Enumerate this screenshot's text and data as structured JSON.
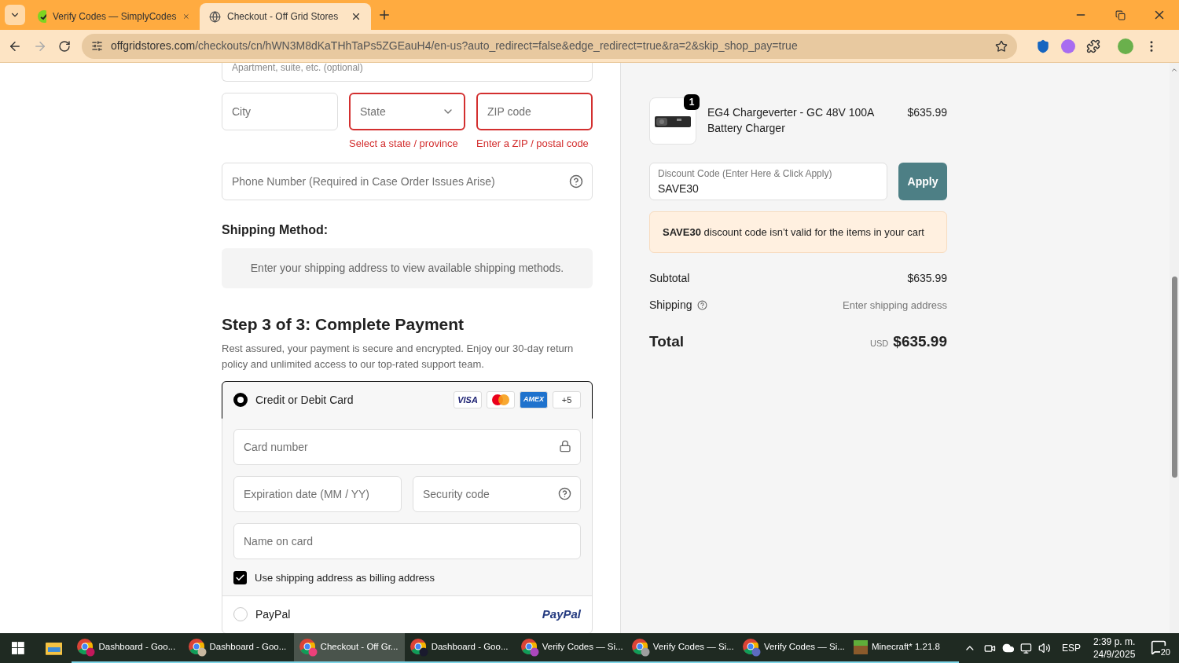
{
  "browser": {
    "tabs": [
      {
        "title": "Verify Codes — SimplyCodes",
        "kind": "simplycodes",
        "selected": false
      },
      {
        "title": "Checkout - Off Grid Stores",
        "kind": "globe",
        "selected": true
      }
    ],
    "url": {
      "domain": "offgridstores.com",
      "path": "/checkouts/cn/hWN3M8dKaTHhTaPs5ZGEauH4/en-us?auto_redirect=false&edge_redirect=true&ra=2&skip_shop_pay=true"
    }
  },
  "address": {
    "apartment": {
      "placeholder": "Apartment, suite, etc. (optional)"
    },
    "fields": [
      {
        "kind": "input",
        "placeholder": "City",
        "invalid": false
      },
      {
        "kind": "select",
        "placeholder": "State",
        "invalid": true,
        "error": "Select a state / province"
      },
      {
        "kind": "input",
        "placeholder": "ZIP code",
        "invalid": true,
        "error": "Enter a ZIP / postal code"
      }
    ],
    "phone": {
      "placeholder": "Phone Number (Required in Case Order Issues Arise)"
    }
  },
  "shipping_method": {
    "title": "Shipping Method:",
    "message": "Enter your shipping address to view available shipping methods."
  },
  "payment": {
    "title": "Step 3 of 3: Complete Payment",
    "description": "Rest assured, your payment is secure and encrypted. Enjoy our 30-day return policy and unlimited access to our top-rated support team.",
    "methods": [
      {
        "kind": "card",
        "label": "Credit or Debit Card",
        "selected": true,
        "brands": [
          {
            "kind": "visa",
            "label": "VISA"
          },
          {
            "kind": "mastercard"
          },
          {
            "kind": "amex",
            "label": "AMEX"
          },
          {
            "kind": "more",
            "label": "+5"
          }
        ],
        "fields": [
          {
            "kind": "number",
            "placeholder": "Card number"
          },
          {
            "kind": "expiry",
            "placeholder": "Expiration date (MM / YY)"
          },
          {
            "kind": "security",
            "placeholder": "Security code"
          },
          {
            "kind": "name",
            "placeholder": "Name on card"
          }
        ],
        "billing": {
          "label": "Use shipping address as billing address",
          "checked": true
        }
      },
      {
        "kind": "paypal",
        "label": "PayPal",
        "selected": false,
        "logo": "PayPal"
      }
    ]
  },
  "summary": {
    "item": {
      "quantity": "1",
      "name": "EG4 Chargeverter - GC 48V 100A Battery Charger",
      "price": "$635.99"
    },
    "discount": {
      "label": "Discount Code (Enter Here & Click Apply)",
      "value": "SAVE30",
      "button": "Apply"
    },
    "alert": "**SAVE30** discount code isn’t valid for the items in your cart",
    "subtotal": {
      "label": "Subtotal",
      "value": "$635.99"
    },
    "shipping": {
      "label": "Shipping",
      "value": "Enter shipping address"
    },
    "total": {
      "label": "Total",
      "currency": "USD",
      "value": "$635.99"
    }
  },
  "taskbar": {
    "apps": [
      {
        "kind": "chrome",
        "label": "Dashboard - Goo...",
        "color": "#c2185b",
        "selected": false
      },
      {
        "kind": "chrome",
        "label": "Dashboard - Goo...",
        "color": "#c8b8a0",
        "selected": false
      },
      {
        "kind": "chrome",
        "label": "Checkout - Off Gr...",
        "color": "#ec407a",
        "selected": true
      },
      {
        "kind": "chrome",
        "label": "Dashboard - Goo...",
        "color": "#1a1a2e",
        "selected": false
      },
      {
        "kind": "chrome",
        "label": "Verify Codes — Si...",
        "color": "#ab47bc",
        "selected": false
      },
      {
        "kind": "chrome",
        "label": "Verify Codes — Si...",
        "color": "#9e9e9e",
        "selected": false
      },
      {
        "kind": "chrome",
        "label": "Verify Codes — Si...",
        "color": "#5c6bc0",
        "selected": false
      },
      {
        "kind": "minecraft",
        "label": "Minecraft* 1.21.8",
        "selected": false
      }
    ],
    "language": "ESP",
    "time": "2:39 p. m.",
    "date": "24/9/2025",
    "notifications": "20"
  }
}
